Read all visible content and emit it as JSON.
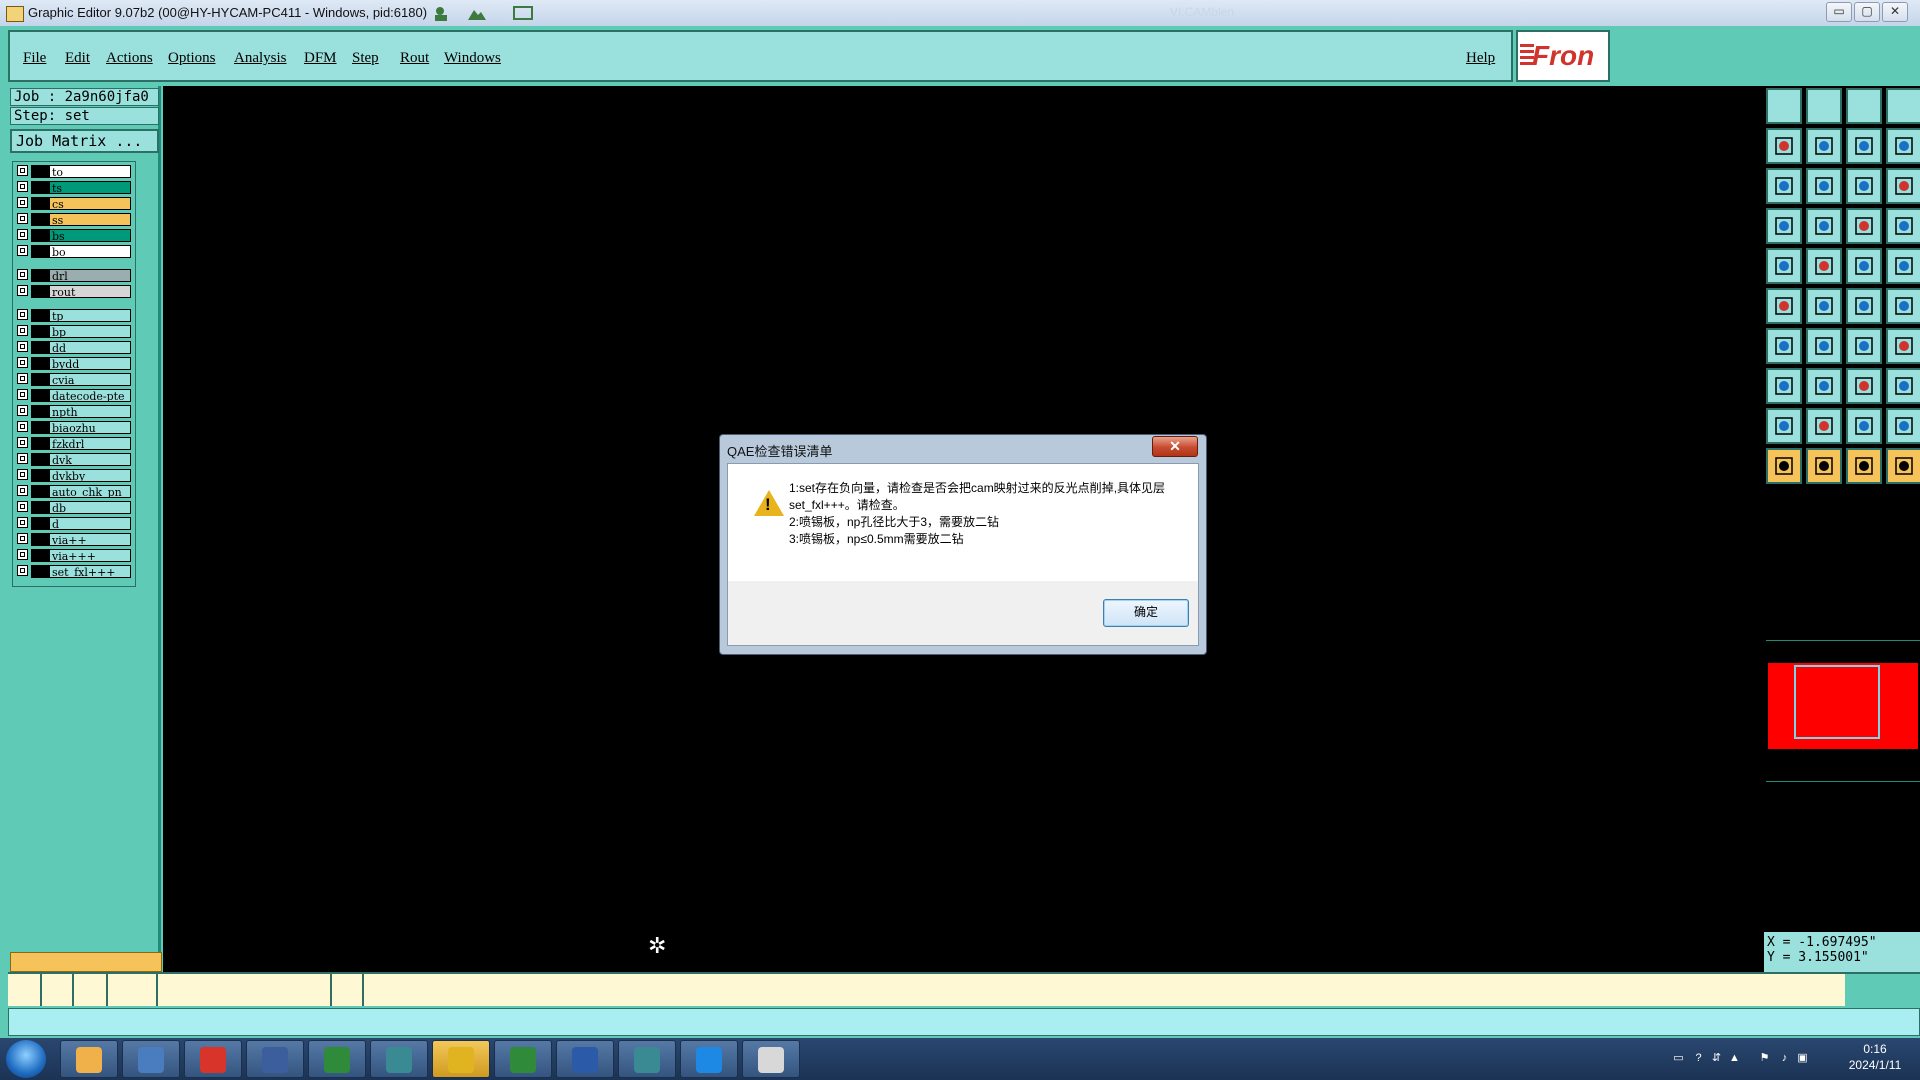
{
  "window": {
    "title": "Graphic Editor 9.07b2 (00@HY-HYCAM-PC411 - Windows, pid:6180)",
    "faded_title": "VI:CAMblen",
    "minimize": "▭",
    "maximize": "▢",
    "close": "✕"
  },
  "menu": {
    "items": [
      {
        "label": "File"
      },
      {
        "label": "Edit"
      },
      {
        "label": "Actions"
      },
      {
        "label": "Options"
      },
      {
        "label": "Analysis"
      },
      {
        "label": "DFM"
      },
      {
        "label": "Step"
      },
      {
        "label": "Rout"
      },
      {
        "label": "Windows"
      }
    ],
    "help": "Help",
    "logo_text": "Fron"
  },
  "job": {
    "job_label": "Job : 2a9n60jfa0",
    "step_label": "Step: set",
    "matrix_button": "Job Matrix ..."
  },
  "layers": [
    {
      "name": "to",
      "color": "#ffffff"
    },
    {
      "name": "ts",
      "color": "#009a7a"
    },
    {
      "name": "cs",
      "color": "#f5c35a"
    },
    {
      "name": "ss",
      "color": "#f5c35a"
    },
    {
      "name": "bs",
      "color": "#009a7a"
    },
    {
      "name": "bo",
      "color": "#ffffff"
    },
    {
      "name": "drl",
      "color": "#9aaeb0"
    },
    {
      "name": "rout",
      "color": "#d6d6d6"
    },
    {
      "name": "tp",
      "color": "#9ae0dc"
    },
    {
      "name": "bp",
      "color": "#9ae0dc"
    },
    {
      "name": "dd",
      "color": "#9ae0dc"
    },
    {
      "name": "bydd",
      "color": "#9ae0dc"
    },
    {
      "name": "cvia",
      "color": "#9ae0dc"
    },
    {
      "name": "datecode-pte",
      "color": "#9ae0dc"
    },
    {
      "name": "npth",
      "color": "#9ae0dc"
    },
    {
      "name": "biaozhu",
      "color": "#9ae0dc"
    },
    {
      "name": "fzkdrl",
      "color": "#9ae0dc"
    },
    {
      "name": "dvk",
      "color": "#9ae0dc"
    },
    {
      "name": "dvkby",
      "color": "#9ae0dc"
    },
    {
      "name": "auto_chk_pn",
      "color": "#9ae0dc"
    },
    {
      "name": "db",
      "color": "#9ae0dc"
    },
    {
      "name": "d",
      "color": "#9ae0dc"
    },
    {
      "name": "via++",
      "color": "#9ae0dc"
    },
    {
      "name": "via+++",
      "color": "#9ae0dc"
    },
    {
      "name": "set_fxl+++",
      "color": "#9ae0dc"
    }
  ],
  "toolbar": {
    "icons": [
      "blank",
      "blank",
      "blank",
      "blank",
      "pan-left-icon",
      "pan-right-icon",
      "undo-zoom-icon",
      "redraw-icon",
      "zoom-fit-icon",
      "zoom-center-icon",
      "scale-1-2-icon",
      "help-query-icon",
      "snap-settings-icon",
      "grid-icon",
      "net-highlight-icon",
      "net-highlight-alt-icon",
      "pad-icon",
      "shape-icon",
      "measure-ruler-icon",
      "circle-fill-icon",
      "node-select-icon",
      "cross-icon",
      "line-endpoint-icon",
      "line-endpoint-alt-icon",
      "angle-icon",
      "slash-icon",
      "arc-icon",
      "frame-icon",
      "pad-mark-icon",
      "minus-line-icon",
      "connect-icon",
      "move-group-icon",
      "triangle-icon",
      "triangle-alt-icon",
      "triangle-outline-icon",
      "triangle-bridge-icon",
      "pointer-icon",
      "pointer-select-icon",
      "pointer-move-icon",
      "pointer-route-icon"
    ]
  },
  "coords": {
    "x": "X = -1.697495\"",
    "y": "Y = 3.155001\""
  },
  "dialog": {
    "title": "QAE检查错误清单",
    "close": "✕",
    "message": [
      "1:set存在负向量，请检查是否会把cam映射过来的反光点削掉,具体见层set_fxl+++。请检查。",
      "2:喷锡板，np孔径比大于3，需要放二钻",
      "3:喷锡板，np≤0.5mm需要放二钻"
    ],
    "ok": "确定"
  },
  "taskbar": {
    "apps": [
      "shell-icon",
      "notepad-icon",
      "app-red-icon",
      "save-disk-icon",
      "app-green-p-icon",
      "eye-icon",
      "genesis-x-icon",
      "excel-icon",
      "word-icon",
      "eye-alt-icon",
      "flag-blue-icon",
      "document-icon"
    ],
    "time": "0:16",
    "date": "2024/1/11"
  }
}
